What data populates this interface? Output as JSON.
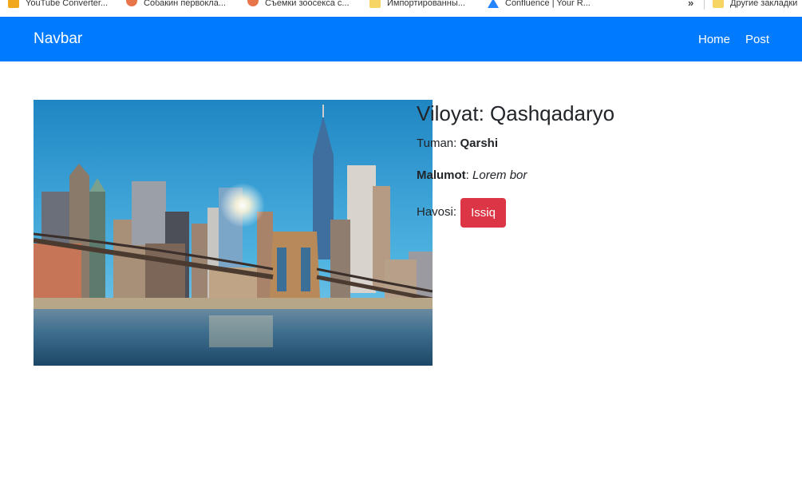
{
  "bookmarks": [
    {
      "label": "YouTube Converter...",
      "icon": "youtube-converter-icon"
    },
    {
      "label": "Собакин первокла...",
      "icon": "bowl-icon"
    },
    {
      "label": "Съемки зоосекса с...",
      "icon": "bowl-icon"
    },
    {
      "label": "Импортированны...",
      "icon": "folder-icon"
    },
    {
      "label": "Confluence | Your R...",
      "icon": "atlassian-icon"
    },
    {
      "label": "Другие закладки",
      "icon": "folder-icon"
    }
  ],
  "bookmarks_more": "»",
  "navbar": {
    "brand": "Navbar",
    "links": [
      "Home",
      "Post"
    ],
    "color": "#007bff"
  },
  "card": {
    "heading": "Viloyat: Qashqadaryo",
    "tuman_label": "Tuman:",
    "tuman_value": "Qarshi",
    "malumot_label": "Malumot",
    "malumot_sep": ":",
    "malumot_value": "Lorem bor",
    "havo_label": "Havosi:",
    "havo_value": "Issiq",
    "havo_color": "#dc3545"
  },
  "image": {
    "subject": "Brooklyn Bridge and Manhattan skyline"
  }
}
